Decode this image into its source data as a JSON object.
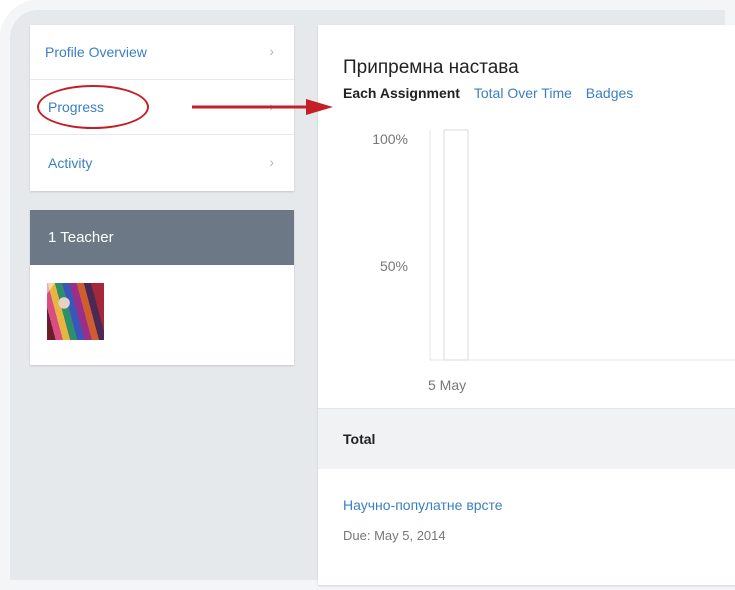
{
  "sidebar": {
    "items": [
      {
        "label": "Profile Overview",
        "chevron": "›"
      },
      {
        "label": "Progress",
        "chevron": "›"
      },
      {
        "label": "Activity",
        "chevron": "›"
      }
    ]
  },
  "teachers": {
    "header": "1 Teacher",
    "avatar_icon": "teacher-avatar"
  },
  "course": {
    "title": "Припремна настава",
    "tabs": [
      {
        "label": "Each Assignment",
        "active": true
      },
      {
        "label": "Total Over Time",
        "active": false
      },
      {
        "label": "Badges",
        "active": false
      }
    ]
  },
  "chart_data": {
    "type": "bar",
    "categories": [
      "5 May"
    ],
    "values": [
      100
    ],
    "ytick_labels": [
      "100%",
      "50%"
    ],
    "ylim": [
      0,
      100
    ],
    "xlabel": "",
    "ylabel": "",
    "grid": false
  },
  "total": {
    "label": "Total"
  },
  "assignment": {
    "name": "Научно-популатне врсте",
    "due": "Due: May 5, 2014"
  },
  "colors": {
    "accent_link": "#3a7fc4",
    "teacher_header": "#6c7886",
    "annotation": "#c41f26"
  }
}
